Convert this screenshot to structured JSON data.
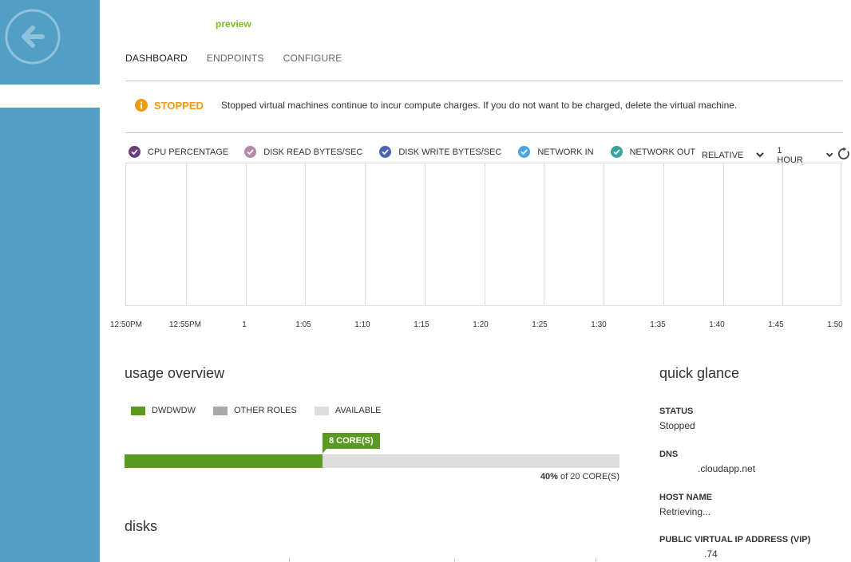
{
  "app": {
    "preview_label": "preview"
  },
  "tabs": [
    {
      "label": "DASHBOARD",
      "active": true
    },
    {
      "label": "ENDPOINTS",
      "active": false
    },
    {
      "label": "CONFIGURE",
      "active": false
    }
  ],
  "alert": {
    "icon": "info-icon",
    "status": "STOPPED",
    "message": "Stopped virtual machines continue to incur compute charges. If you do not want to be charged, delete the virtual machine."
  },
  "chart": {
    "legend": [
      {
        "label": "CPU PERCENTAGE",
        "color": "#6b3d7d",
        "checked": true
      },
      {
        "label": "DISK READ BYTES/SEC",
        "color": "#b48aac",
        "checked": true
      },
      {
        "label": "DISK WRITE BYTES/SEC",
        "color": "#4b65b3",
        "checked": true
      },
      {
        "label": "NETWORK IN",
        "color": "#4aa3e3",
        "checked": true
      },
      {
        "label": "NETWORK OUT",
        "color": "#39a3a0",
        "checked": true
      }
    ],
    "mode_label": "RELATIVE",
    "range_label": "1 HOUR",
    "time_ticks": [
      "12:50PM",
      "12:55PM",
      "1",
      "1:05",
      "1:10",
      "1:15",
      "1:20",
      "1:25",
      "1:30",
      "1:35",
      "1:40",
      "1:45",
      "1:50"
    ]
  },
  "usage": {
    "title": "usage overview",
    "legend": [
      {
        "label": "DWDWDW",
        "color": "#5a9a23"
      },
      {
        "label": "OTHER ROLES",
        "color": "#a8a8a8"
      },
      {
        "label": "AVAILABLE",
        "color": "#dddddd"
      }
    ],
    "badge": "8 CORE(S)",
    "fraction": 0.4,
    "caption_percent": "40%",
    "caption_rest": " of 20 CORE(S)"
  },
  "disks": {
    "title": "disks"
  },
  "quick_glance": {
    "title": "quick glance",
    "items": [
      {
        "label": "STATUS",
        "value": "Stopped"
      },
      {
        "label": "DNS",
        "value": ".cloudapp.net"
      },
      {
        "label": "HOST NAME",
        "value": "Retrieving..."
      },
      {
        "label": "PUBLIC VIRTUAL IP ADDRESS (VIP)",
        "value": ".74"
      }
    ]
  }
}
